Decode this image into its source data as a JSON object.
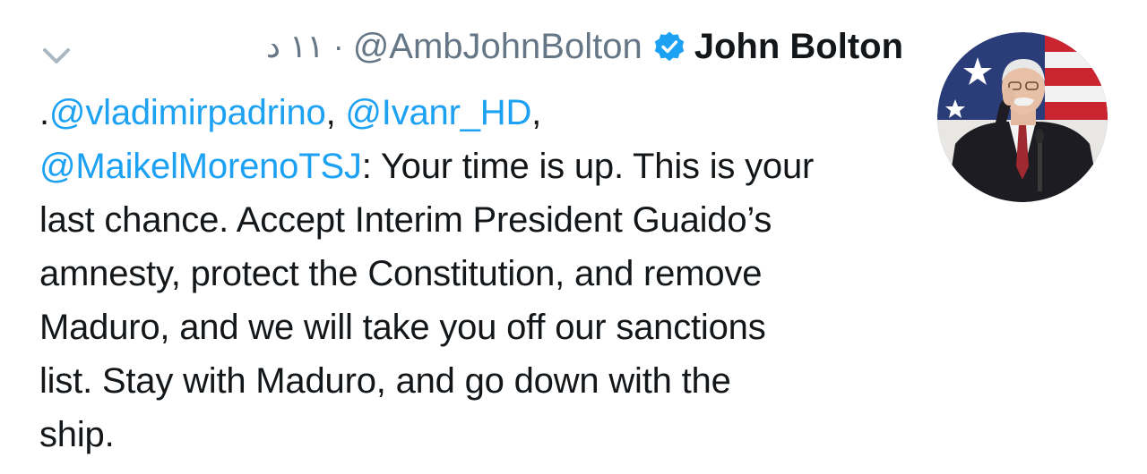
{
  "tweet": {
    "author": {
      "name": "John Bolton",
      "handle": "@AmbJohnBolton",
      "verified_icon": "verified-badge-icon",
      "avatar_icon": "profile-photo"
    },
    "time": "١١ د",
    "separator": "·",
    "menu_icon": "chevron-down-icon",
    "body": {
      "lead": ".",
      "mention1": "@vladimirpadrino",
      "sep1": ", ",
      "mention2": "@Ivanr_HD",
      "sep2": ",",
      "mention3": "@MaikelMorenoTSJ",
      "line2_rest": ": Your time is up. This is your",
      "line3": "last chance. Accept Interim President Guaido’s",
      "line4": "amnesty, protect the Constitution, and remove",
      "line5": "Maduro, and we will take you off our sanctions",
      "line6": "list. Stay with Maduro, and go down with the",
      "line7": "ship."
    }
  },
  "colors": {
    "link": "#1da1f2",
    "muted": "#657786",
    "text": "#14171a",
    "verified": "#1da1f2"
  }
}
